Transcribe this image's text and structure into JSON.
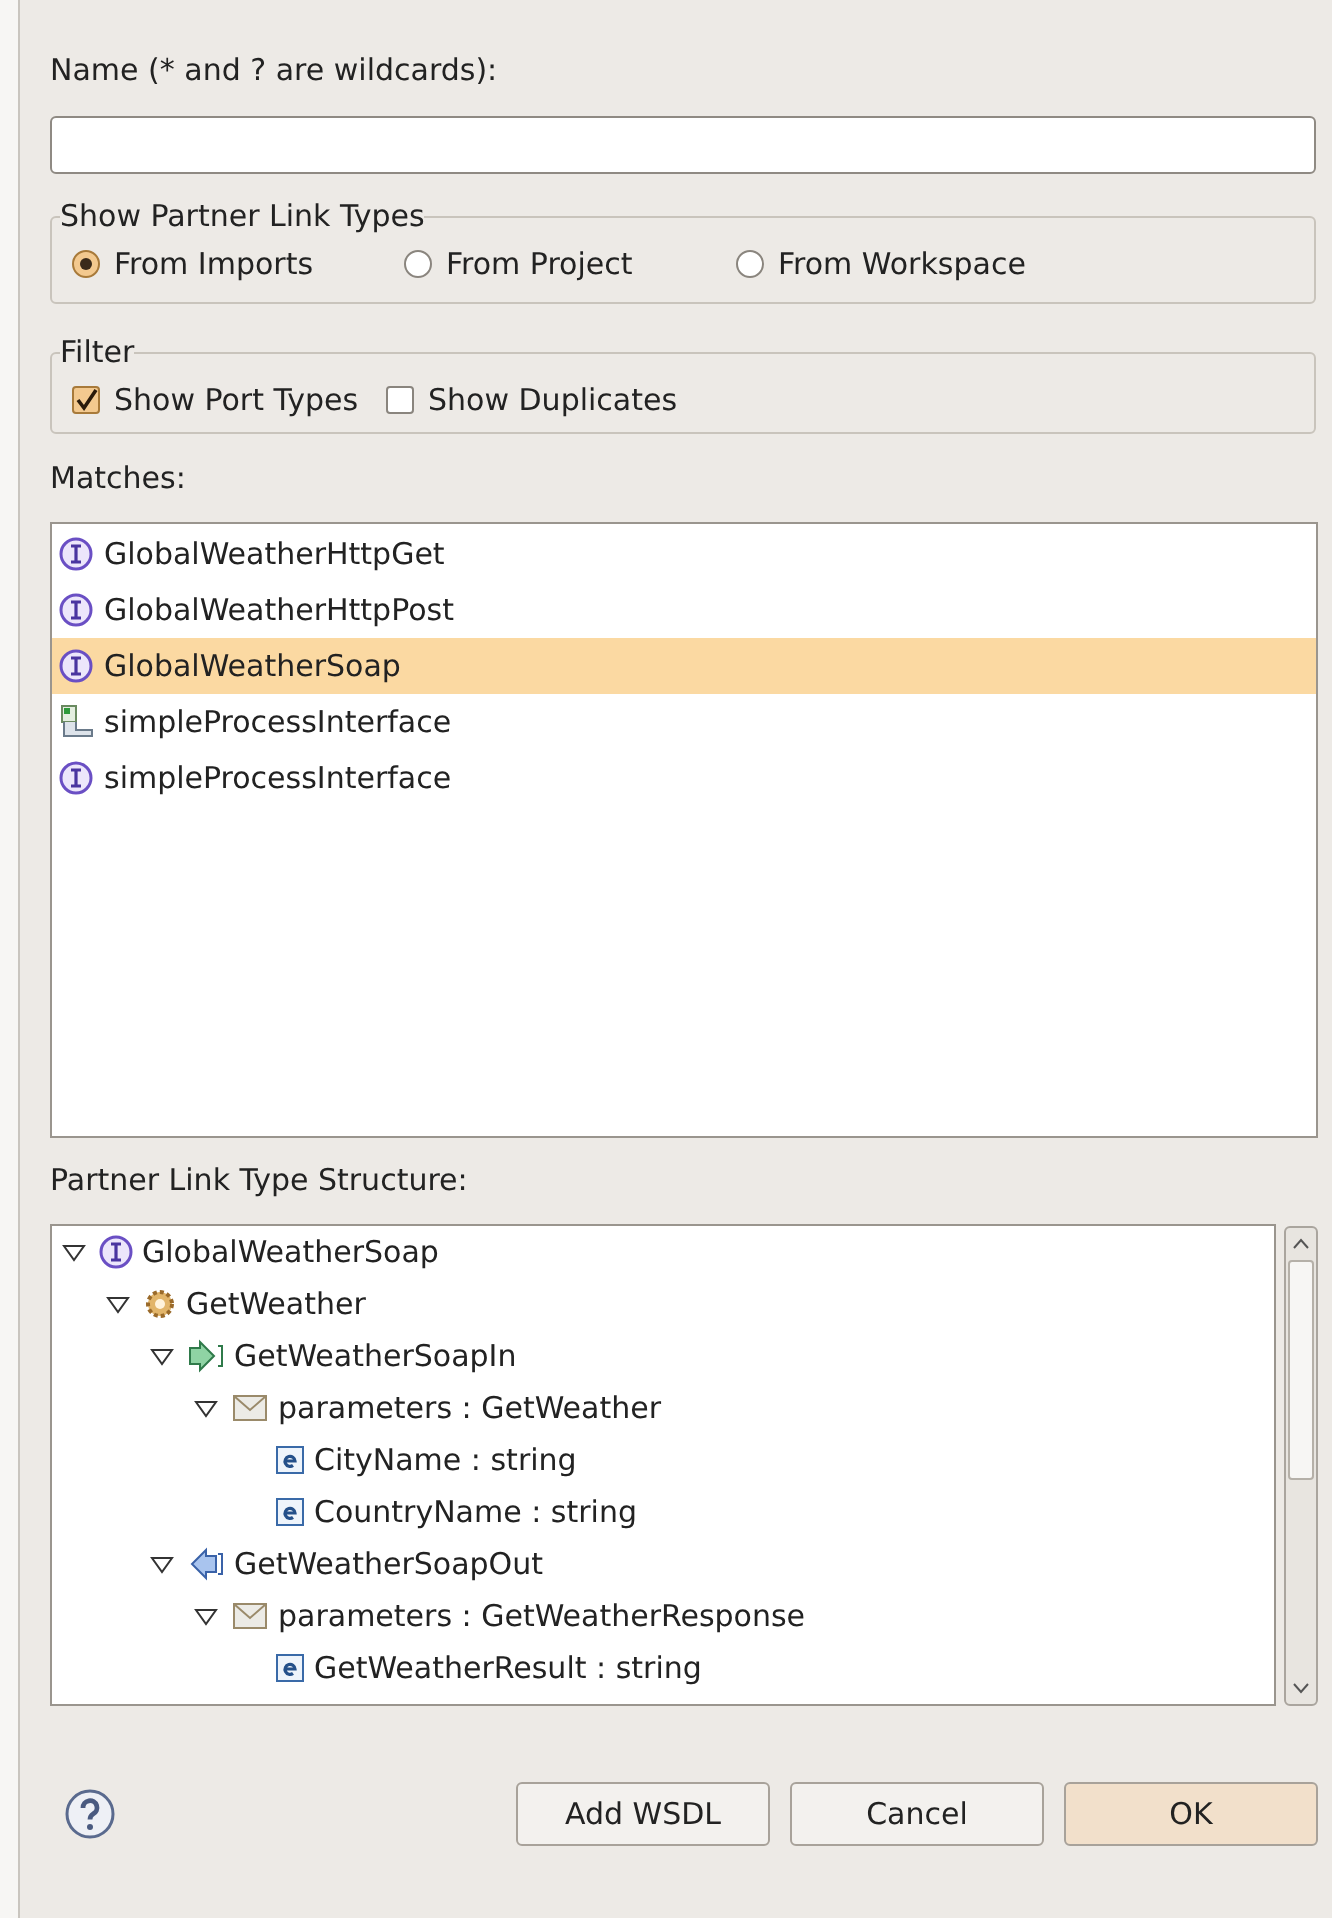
{
  "name_field": {
    "label": "Name (* and ? are wildcards):"
  },
  "partner_link_types": {
    "title": "Show Partner Link Types",
    "options": [
      {
        "label": "From Imports",
        "selected": true
      },
      {
        "label": "From Project",
        "selected": false
      },
      {
        "label": "From Workspace",
        "selected": false
      }
    ]
  },
  "filter": {
    "title": "Filter",
    "options": [
      {
        "label": "Show Port Types",
        "checked": true
      },
      {
        "label": "Show Duplicates",
        "checked": false
      }
    ]
  },
  "matches": {
    "label": "Matches:",
    "items": [
      {
        "kind": "interface",
        "label": "GlobalWeatherHttpGet",
        "selected": false
      },
      {
        "kind": "interface",
        "label": "GlobalWeatherHttpPost",
        "selected": false
      },
      {
        "kind": "interface",
        "label": "GlobalWeatherSoap",
        "selected": true
      },
      {
        "kind": "process",
        "label": "simpleProcessInterface",
        "selected": false
      },
      {
        "kind": "interface",
        "label": "simpleProcessInterface",
        "selected": false
      }
    ]
  },
  "structure": {
    "label": "Partner Link Type Structure:",
    "tree": [
      {
        "kind": "interface",
        "label": "GlobalWeatherSoap",
        "expanded": true,
        "children": [
          {
            "kind": "operation",
            "label": "GetWeather",
            "expanded": true,
            "children": [
              {
                "kind": "input",
                "label": "GetWeatherSoapIn",
                "expanded": true,
                "children": [
                  {
                    "kind": "message",
                    "label": "parameters : GetWeather",
                    "expanded": true,
                    "children": [
                      {
                        "kind": "element",
                        "label": "CityName : string"
                      },
                      {
                        "kind": "element",
                        "label": "CountryName : string"
                      }
                    ]
                  }
                ]
              },
              {
                "kind": "output",
                "label": "GetWeatherSoapOut",
                "expanded": true,
                "children": [
                  {
                    "kind": "message",
                    "label": "parameters : GetWeatherResponse",
                    "expanded": true,
                    "children": [
                      {
                        "kind": "element",
                        "label": "GetWeatherResult : string"
                      }
                    ]
                  }
                ]
              }
            ]
          }
        ]
      }
    ]
  },
  "buttons": [
    {
      "label": "Add WSDL",
      "default": false
    },
    {
      "label": "Cancel",
      "default": false
    },
    {
      "label": "OK",
      "default": true
    }
  ]
}
